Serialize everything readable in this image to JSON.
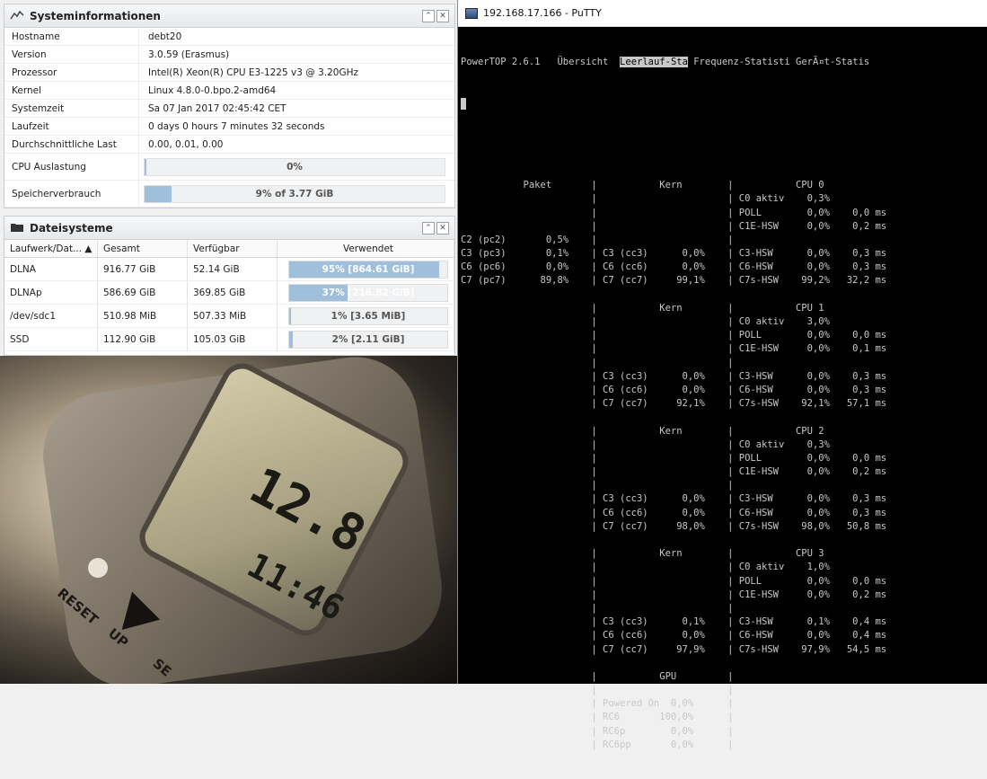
{
  "sysinfo": {
    "title": "Systeminformationen",
    "rows": [
      {
        "key": "Hostname",
        "value": "debt20"
      },
      {
        "key": "Version",
        "value": "3.0.59 (Erasmus)"
      },
      {
        "key": "Prozessor",
        "value": "Intel(R) Xeon(R) CPU E3-1225 v3 @ 3.20GHz"
      },
      {
        "key": "Kernel",
        "value": "Linux 4.8.0-0.bpo.2-amd64"
      },
      {
        "key": "Systemzeit",
        "value": "Sa 07 Jan 2017 02:45:42 CET"
      },
      {
        "key": "Laufzeit",
        "value": "0 days 0 hours 7 minutes 32 seconds"
      },
      {
        "key": "Durchschnittliche Last",
        "value": "0.00, 0.01, 0.00"
      }
    ],
    "cpu": {
      "label": "CPU Auslastung",
      "text": "0%",
      "fraction": 0.005
    },
    "mem": {
      "label": "Speicherverbrauch",
      "text": "9% of 3.77 GiB",
      "fraction": 0.09
    }
  },
  "fs": {
    "title": "Dateisysteme",
    "columns": [
      "Laufwerk/Dat... ▲",
      "Gesamt",
      "Verfügbar",
      "Verwendet"
    ],
    "rows": [
      {
        "name": "DLNA",
        "total": "916.77 GiB",
        "avail": "52.14 GiB",
        "used": "95% [864.61 GiB]",
        "fraction": 0.95
      },
      {
        "name": "DLNAp",
        "total": "586.69 GiB",
        "avail": "369.85 GiB",
        "used": "37% [216.82 GiB]",
        "fraction": 0.37
      },
      {
        "name": "/dev/sdc1",
        "total": "510.98 MiB",
        "avail": "507.33 MiB",
        "used": "1% [3.65 MiB]",
        "fraction": 0.01
      },
      {
        "name": "SSD",
        "total": "112.90 GiB",
        "avail": "105.03 GiB",
        "used": "2% [2.11 GiB]",
        "fraction": 0.02
      }
    ]
  },
  "photo": {
    "speed": "12.8",
    "time": "11:46",
    "labels": [
      "RESET",
      "UP",
      "SE"
    ]
  },
  "putty": {
    "title": "192.168.17.166 - PuTTY",
    "tabs": [
      "PowerTOP 2.6.1",
      "Übersicht",
      "Leerlauf-Sta",
      "Frequenz-Statisti",
      "GerÃ¤t-Statis"
    ],
    "lines": [
      "",
      "",
      "",
      "           Paket       |           Kern        |           CPU 0",
      "                       |                       | C0 aktiv    0,3%",
      "                       |                       | POLL        0,0%    0,0 ms",
      "                       |                       | C1E-HSW     0,0%    0,2 ms",
      "C2 (pc2)       0,5%    |                       |",
      "C3 (pc3)       0,1%    | C3 (cc3)      0,0%    | C3-HSW      0,0%    0,3 ms",
      "C6 (pc6)       0,0%    | C6 (cc6)      0,0%    | C6-HSW      0,0%    0,3 ms",
      "C7 (pc7)      89,8%    | C7 (cc7)     99,1%    | C7s-HSW    99,2%   32,2 ms",
      "",
      "                       |           Kern        |           CPU 1",
      "                       |                       | C0 aktiv    3,0%",
      "                       |                       | POLL        0,0%    0,0 ms",
      "                       |                       | C1E-HSW     0,0%    0,1 ms",
      "                       |                       |",
      "                       | C3 (cc3)      0,0%    | C3-HSW      0,0%    0,3 ms",
      "                       | C6 (cc6)      0,0%    | C6-HSW      0,0%    0,3 ms",
      "                       | C7 (cc7)     92,1%    | C7s-HSW    92,1%   57,1 ms",
      "",
      "                       |           Kern        |           CPU 2",
      "                       |                       | C0 aktiv    0,3%",
      "                       |                       | POLL        0,0%    0,0 ms",
      "                       |                       | C1E-HSW     0,0%    0,2 ms",
      "                       |                       |",
      "                       | C3 (cc3)      0,0%    | C3-HSW      0,0%    0,3 ms",
      "                       | C6 (cc6)      0,0%    | C6-HSW      0,0%    0,3 ms",
      "                       | C7 (cc7)     98,0%    | C7s-HSW    98,0%   50,8 ms",
      "",
      "                       |           Kern        |           CPU 3",
      "                       |                       | C0 aktiv    1,0%",
      "                       |                       | POLL        0,0%    0,0 ms",
      "                       |                       | C1E-HSW     0,0%    0,2 ms",
      "                       |                       |",
      "                       | C3 (cc3)      0,1%    | C3-HSW      0,1%    0,4 ms",
      "                       | C6 (cc6)      0,0%    | C6-HSW      0,0%    0,4 ms",
      "                       | C7 (cc7)     97,9%    | C7s-HSW    97,9%   54,5 ms",
      "",
      "                       |           GPU         |",
      "                       |                       |",
      "                       | Powered On  0,0%      |",
      "                       | RC6       100,0%      |",
      "                       | RC6p        0,0%      |",
      "                       | RC6pp       0,0%      |"
    ]
  }
}
